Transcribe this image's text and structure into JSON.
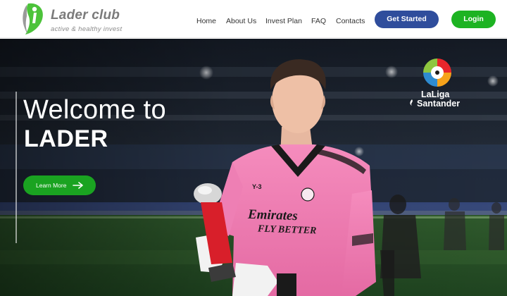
{
  "header": {
    "logo": {
      "title": "Lader club",
      "tagline": "active & healthy  invest",
      "icon": "leaf-figure-icon",
      "colors": {
        "green": "#4cc33a",
        "grey": "#7b7b7b"
      }
    },
    "nav": [
      {
        "label": "Home"
      },
      {
        "label": "About Us"
      },
      {
        "label": "Invest Plan"
      },
      {
        "label": "FAQ"
      },
      {
        "label": "Contacts"
      }
    ],
    "get_started_label": "Get Started",
    "login_label": "Login",
    "colors": {
      "get_started": "#2f4d9c",
      "login": "#1db322"
    }
  },
  "hero": {
    "welcome": "Welcome to",
    "brand": "LADER",
    "learn_more_label": "Learn More",
    "learn_more_icon": "arrow-right-icon",
    "colors": {
      "learn_more": "#1aa321",
      "jersey": "#f07fb4"
    },
    "league_logo": {
      "line1": "LaLiga",
      "line2": "Santander",
      "icon": "laliga-ball-icon"
    },
    "photo_text": {
      "sponsor": "Emirates",
      "tagline": "FLY BETTER",
      "badge": "Y-3"
    }
  }
}
